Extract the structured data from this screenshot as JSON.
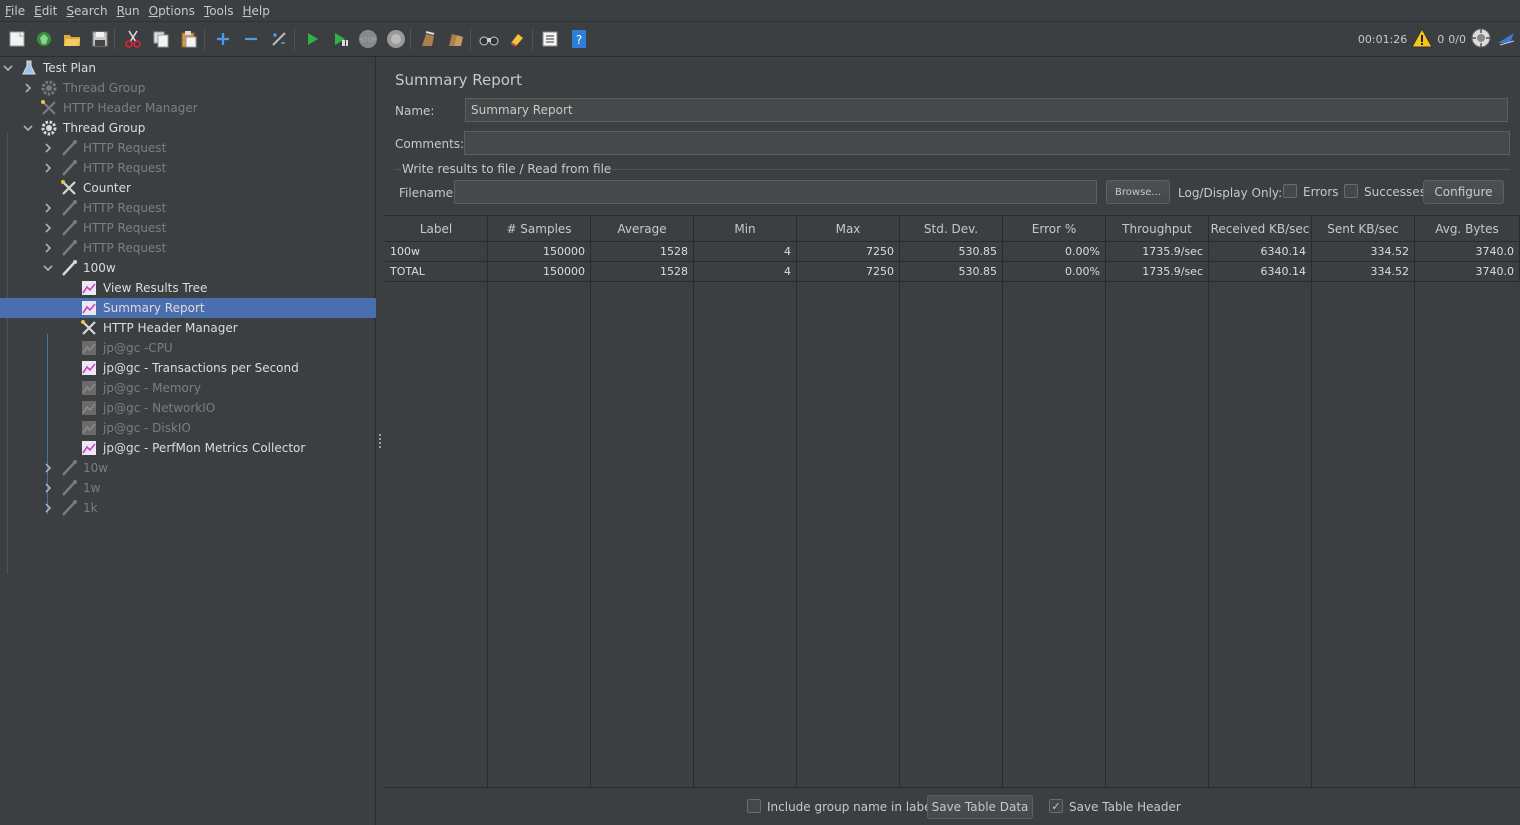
{
  "menu": [
    {
      "label": "File",
      "mnemonic": "F",
      "rest": "ile"
    },
    {
      "label": "Edit",
      "mnemonic": "E",
      "rest": "dit"
    },
    {
      "label": "Search",
      "mnemonic": "S",
      "rest": "earch"
    },
    {
      "label": "Run",
      "mnemonic": "R",
      "rest": "un"
    },
    {
      "label": "Options",
      "mnemonic": "O",
      "rest": "ptions"
    },
    {
      "label": "Tools",
      "mnemonic": "T",
      "rest": "ools"
    },
    {
      "label": "Help",
      "mnemonic": "H",
      "rest": "elp"
    }
  ],
  "toolbar": {
    "elapsed_time": "00:01:26",
    "warning_count": "0",
    "threads": "0/0"
  },
  "tree": [
    {
      "label": "Test Plan",
      "enabled": true,
      "icon": "flask-icon"
    },
    {
      "label": "Thread Group",
      "enabled": false,
      "icon": "gear-icon"
    },
    {
      "label": "HTTP Header Manager",
      "enabled": false,
      "icon": "tools-icon"
    },
    {
      "label": "Thread Group",
      "enabled": true,
      "icon": "gear-icon"
    },
    {
      "label": "HTTP Request",
      "enabled": false,
      "icon": "pipette-icon"
    },
    {
      "label": "HTTP Request",
      "enabled": false,
      "icon": "pipette-icon"
    },
    {
      "label": "Counter",
      "enabled": true,
      "icon": "tools-icon"
    },
    {
      "label": "HTTP Request",
      "enabled": false,
      "icon": "pipette-icon"
    },
    {
      "label": "HTTP Request",
      "enabled": false,
      "icon": "pipette-icon"
    },
    {
      "label": "HTTP Request",
      "enabled": false,
      "icon": "pipette-icon"
    },
    {
      "label": "100w",
      "enabled": true,
      "icon": "pipette-icon"
    },
    {
      "label": "View Results Tree",
      "enabled": true,
      "icon": "chart-icon"
    },
    {
      "label": "Summary Report",
      "enabled": true,
      "icon": "chart-icon"
    },
    {
      "label": "HTTP Header Manager",
      "enabled": true,
      "icon": "tools-icon"
    },
    {
      "label": "jp@gc -CPU",
      "enabled": false,
      "icon": "chart-icon"
    },
    {
      "label": "jp@gc - Transactions per Second",
      "enabled": true,
      "icon": "chart-icon"
    },
    {
      "label": "jp@gc - Memory",
      "enabled": false,
      "icon": "chart-icon"
    },
    {
      "label": "jp@gc - NetworkIO",
      "enabled": false,
      "icon": "chart-icon"
    },
    {
      "label": "jp@gc - DiskIO",
      "enabled": false,
      "icon": "chart-icon"
    },
    {
      "label": "jp@gc - PerfMon Metrics Collector",
      "enabled": true,
      "icon": "chart-icon"
    },
    {
      "label": "10w",
      "enabled": false,
      "icon": "pipette-icon"
    },
    {
      "label": "1w",
      "enabled": false,
      "icon": "pipette-icon"
    },
    {
      "label": "1k",
      "enabled": false,
      "icon": "pipette-icon"
    }
  ],
  "panel": {
    "title": "Summary Report",
    "name_label": "Name:",
    "name_value": "Summary Report",
    "comments_label": "Comments:",
    "comments_value": "",
    "file_group_title": "Write results to file / Read from file",
    "filename_label": "Filename",
    "filename_value": "",
    "browse_label": "Browse...",
    "log_display_label": "Log/Display Only:",
    "errors_label": "Errors",
    "successes_label": "Successes",
    "configure_label": "Configure"
  },
  "table": {
    "headers": [
      "Label",
      "# Samples",
      "Average",
      "Min",
      "Max",
      "Std. Dev.",
      "Error %",
      "Throughput",
      "Received KB/sec",
      "Sent KB/sec",
      "Avg. Bytes"
    ],
    "rows": [
      [
        "100w",
        "150000",
        "1528",
        "4",
        "7250",
        "530.85",
        "0.00%",
        "1735.9/sec",
        "6340.14",
        "334.52",
        "3740.0"
      ],
      [
        "TOTAL",
        "150000",
        "1528",
        "4",
        "7250",
        "530.85",
        "0.00%",
        "1735.9/sec",
        "6340.14",
        "334.52",
        "3740.0"
      ]
    ]
  },
  "bottom": {
    "include_group_label": "Include group name in label?",
    "save_table_data_label": "Save Table Data",
    "save_table_header_label": "Save Table Header"
  }
}
